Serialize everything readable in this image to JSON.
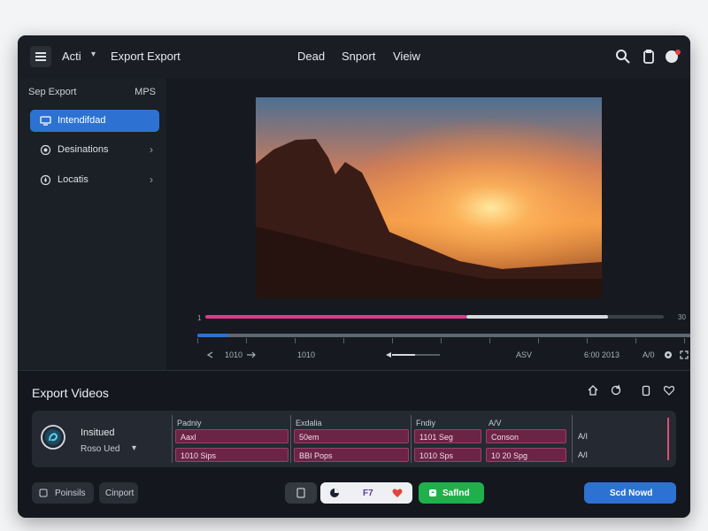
{
  "titlebar": {
    "menu_left": "Acti",
    "export_label": "Export Export",
    "center_items": [
      "Dead",
      "Snport",
      "Vieiw"
    ],
    "icons": [
      "search-icon",
      "clipboard-icon",
      "avatar-icon"
    ]
  },
  "sidebar": {
    "header_left": "Sep Export",
    "header_right": "MPS",
    "items": [
      {
        "label": "Intendifdad",
        "icon": "monitor-icon"
      },
      {
        "label": "Desinations",
        "icon": "destination-icon"
      },
      {
        "label": "Locatis",
        "icon": "location-icon"
      }
    ]
  },
  "timeline": {
    "left_marker": "1",
    "right_marker": "30",
    "meta": [
      "1010",
      "1010",
      "ASV",
      "6:00 2013",
      "A/0"
    ],
    "progress": {
      "playback": 0.57,
      "buffer": 0.12
    }
  },
  "export_section": {
    "title": "Export Videos",
    "action_icons": [
      "home-icon",
      "refresh-icon",
      "clipboard-icon",
      "heart-icon"
    ],
    "row_icon": "swirl-icon",
    "row_name": "Insitued",
    "row_sub": "Roso Ued",
    "columns": [
      "Padniy",
      "Exdalia",
      "Fndiy",
      "A/V"
    ],
    "rows": [
      [
        "Aaxl",
        "50em",
        "1101 Seg",
        "Conson",
        "A/I"
      ],
      [
        "1010 Sips",
        "BBI Pops",
        "1010 Sps",
        "10 20 Spg",
        "A/I"
      ]
    ]
  },
  "bottom_bar": {
    "left_buttons": [
      "Poinsils",
      "Cinport"
    ],
    "format_label": "F7",
    "start_label": "Saflnd",
    "primary_label": "Scd Nowd"
  },
  "colors": {
    "accent": "#2d72d2",
    "success": "#20b04b",
    "playback": "#dd3b8c",
    "danger": "#e0443d"
  }
}
